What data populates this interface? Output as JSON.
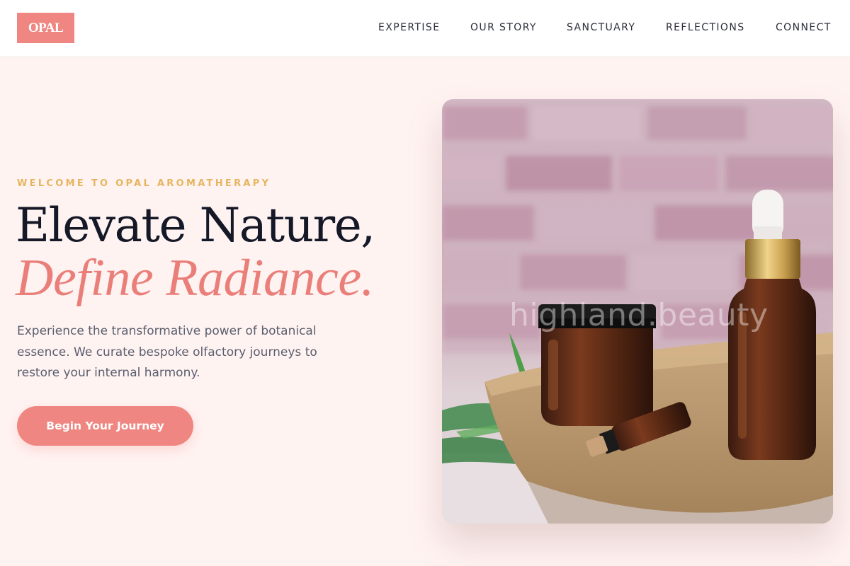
{
  "brand": {
    "logo_text": "OPAL",
    "logo_color": "#ef8681"
  },
  "nav": {
    "items": [
      {
        "label": "EXPERTISE"
      },
      {
        "label": "OUR STORY"
      },
      {
        "label": "SANCTUARY"
      },
      {
        "label": "REFLECTIONS"
      },
      {
        "label": "CONNECT"
      }
    ]
  },
  "hero": {
    "eyebrow": "WELCOME TO OPAL AROMATHERAPY",
    "headline_line1": "Elevate Nature,",
    "headline_line2": "Define Radiance.",
    "lede": "Experience the transformative power of botanical essence. We curate bespoke olfactory journeys to restore your internal harmony.",
    "cta_label": "Begin Your Journey",
    "image": {
      "watermark": "highland.beauty",
      "icon": "aromatherapy-bottles-photo"
    }
  },
  "colors": {
    "accent": "#ef8681",
    "eyebrow": "#e5b55f",
    "heading": "#151827",
    "body_text": "#5a5e6d",
    "background": "#fff3f2"
  }
}
